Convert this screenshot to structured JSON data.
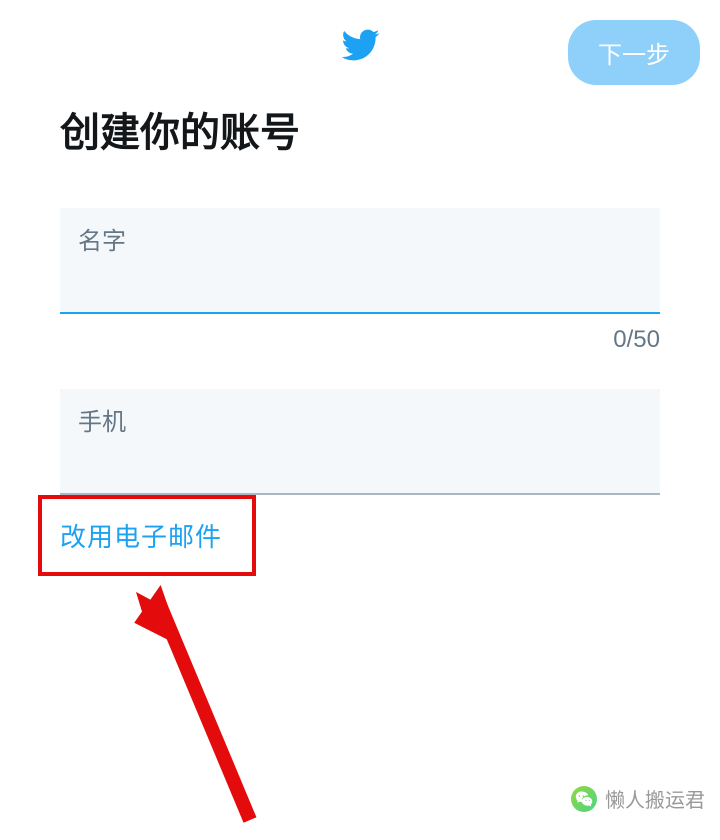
{
  "header": {
    "next_label": "下一步"
  },
  "title": "创建你的账号",
  "name_field": {
    "placeholder": "名字",
    "counter": "0/50"
  },
  "phone_field": {
    "placeholder": "手机"
  },
  "switch_link": "改用电子邮件",
  "watermark": "懒人搬运君"
}
